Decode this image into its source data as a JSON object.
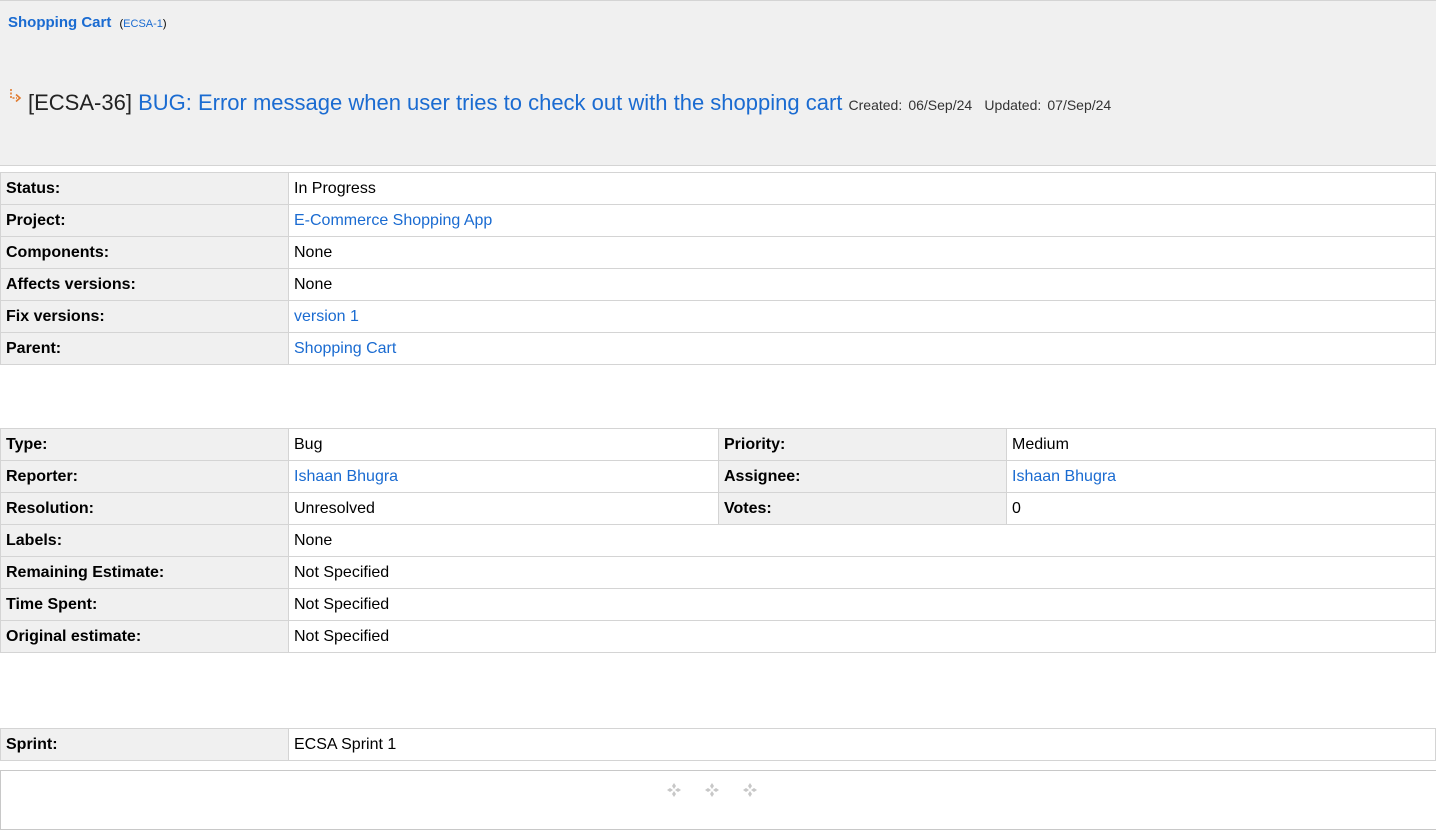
{
  "header": {
    "parent_label": "Shopping Cart",
    "parent_key": "ECSA-1",
    "key": "[ECSA-36]",
    "summary": "BUG: Error message when user tries to check out with the shopping cart",
    "created_label": "Created:",
    "created_value": "06/Sep/24",
    "updated_label": "Updated:",
    "updated_value": "07/Sep/24"
  },
  "details": {
    "status_label": "Status:",
    "status_value": "In Progress",
    "project_label": "Project:",
    "project_value": "E-Commerce Shopping App",
    "components_label": "Components:",
    "components_value": "None",
    "affects_label": "Affects versions:",
    "affects_value": "None",
    "fix_label": "Fix versions:",
    "fix_value": "version 1",
    "parent_label": "Parent:",
    "parent_value": "Shopping Cart"
  },
  "people": {
    "type_label": "Type:",
    "type_value": "Bug",
    "priority_label": "Priority:",
    "priority_value": "Medium",
    "reporter_label": "Reporter:",
    "reporter_value": "Ishaan Bhugra",
    "assignee_label": "Assignee:",
    "assignee_value": "Ishaan Bhugra",
    "resolution_label": "Resolution:",
    "resolution_value": "Unresolved",
    "votes_label": "Votes:",
    "votes_value": "0",
    "labels_label": "Labels:",
    "labels_value": "None",
    "remaining_label": "Remaining Estimate:",
    "remaining_value": "Not Specified",
    "timespent_label": "Time Spent:",
    "timespent_value": "Not Specified",
    "original_label": "Original estimate:",
    "original_value": "Not Specified"
  },
  "agile": {
    "sprint_label": "Sprint:",
    "sprint_value": "ECSA Sprint 1"
  },
  "icons": {
    "subtask": "subtask-icon",
    "ornament": "ornament-icon"
  },
  "colors": {
    "link": "#1a6bd1",
    "label_bg": "#f0f0f0",
    "border": "#d4d4d4"
  }
}
